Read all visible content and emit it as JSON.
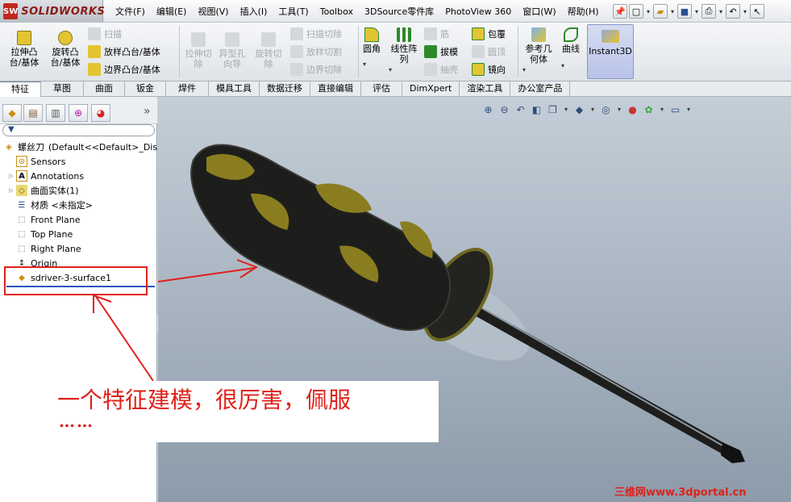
{
  "app": {
    "logo": "SOLIDWORKS",
    "logo_icon": "ds-solidworks-icon"
  },
  "menus": [
    "文件(F)",
    "编辑(E)",
    "视图(V)",
    "插入(I)",
    "工具(T)",
    "Toolbox",
    "3DSource零件库",
    "PhotoView 360",
    "窗口(W)",
    "帮助(H)"
  ],
  "ribbon": {
    "extrude": "拉伸凸\n台/基体",
    "revolve": "旋转凸\n台/基体",
    "sweep": "扫描",
    "loft": "放样凸台/基体",
    "boundary": "边界凸台/基体",
    "extrude_cut": "拉伸切\n除",
    "hole_wizard": "异型孔\n向导",
    "revolve_cut": "旋转切\n除",
    "swept_cut": "扫描切除",
    "lofted_cut": "放样切割",
    "boundary_cut": "边界切除",
    "fillet": "圆角",
    "linear_pattern": "线性阵\n列",
    "rib": "筋",
    "draft": "拔模",
    "shell": "抽壳",
    "wrap": "包覆",
    "dome": "圆顶",
    "mirror": "镜向",
    "ref_geometry": "参考几\n何体",
    "curves": "曲线",
    "instant3d": "Instant3D"
  },
  "tabs": [
    "特征",
    "草图",
    "曲面",
    "钣金",
    "焊件",
    "模具工具",
    "数据迁移",
    "直接编辑",
    "评估",
    "DimXpert",
    "渲染工具",
    "办公室产品"
  ],
  "feature_tree": {
    "root": "螺丝刀",
    "root_suffix": "(Default<<Default>_Displa",
    "items": [
      "Sensors",
      "Annotations",
      "曲面实体(1)",
      "材质 <未指定>",
      "Front Plane",
      "Top Plane",
      "Right Plane",
      "Origin",
      "sdriver-3-surface1"
    ],
    "collapse_glyph": "»"
  },
  "annotation": {
    "line1": "一个特征建模，很厉害，佩服",
    "line2": "……"
  },
  "watermark": "三维网www.3dportal.cn",
  "colors": {
    "annotation_red": "#e0201a",
    "handle_black": "#1d1e1c",
    "grip_yellow": "#8a7d20"
  }
}
